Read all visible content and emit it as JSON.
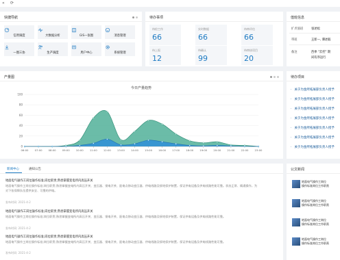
{
  "topbar": {
    "back": "«",
    "refresh": "⟳"
  },
  "quick_nav": {
    "title": "快捷导航",
    "items": [
      {
        "label": "信用调度",
        "icon": "gauge-icon"
      },
      {
        "label": "大数据分析",
        "icon": "pulse-icon"
      },
      {
        "label": "GIS一张图",
        "icon": "book-icon"
      },
      {
        "label": "消息管理",
        "icon": "smile-icon"
      },
      {
        "label": "一图三协",
        "icon": "download-icon"
      },
      {
        "label": "生产调度",
        "icon": "users-icon"
      },
      {
        "label": "用户中心",
        "icon": "user-icon"
      },
      {
        "label": "系统管理",
        "icon": "gear-icon"
      }
    ]
  },
  "todo": {
    "title": "待办事项",
    "items": [
      {
        "label": "待检工作",
        "value": "66"
      },
      {
        "label": "实时数据",
        "value": "66"
      },
      {
        "label": "待审评估",
        "value": "66"
      },
      {
        "label": "待上报",
        "value": "12"
      },
      {
        "label": "待确认",
        "value": "99"
      },
      {
        "label": "待审核项目",
        "value": "20"
      }
    ]
  },
  "note": {
    "title": "值班信息",
    "rows": [
      {
        "key": "扩点值班",
        "value": "张述松"
      },
      {
        "key": "带班",
        "value": "王新一, 谭述毅"
      },
      {
        "key": "备注",
        "value": "西季 \"云控\" 期"
      }
    ],
    "extra": "间有序运行"
  },
  "production": {
    "title": "产量图",
    "chart_title": "今日产量趋势"
  },
  "chart_data": {
    "type": "area",
    "title": "今日产量趋势",
    "x": [
      "06:00",
      "07:00",
      "08:00",
      "09:00",
      "10:00",
      "11:00",
      "12:00",
      "13:00",
      "14:00",
      "15:00",
      "16:00",
      "17:00",
      "18:00",
      "19:00",
      "20:00",
      "21:00",
      "22:00",
      "23:00"
    ],
    "ylim": [
      0,
      100
    ],
    "yticks": [
      "100",
      "80",
      "60",
      "40",
      "20",
      "0"
    ],
    "series": [
      {
        "color": "#3aa58b",
        "values": [
          0,
          0,
          0,
          2,
          12,
          55,
          67,
          13,
          29,
          50,
          43,
          24,
          11,
          7,
          9,
          3,
          2,
          0
        ]
      },
      {
        "color": "#2f8fd8",
        "values": [
          0,
          0,
          0,
          0,
          2,
          6,
          14,
          3,
          5,
          12,
          9,
          5,
          2,
          1,
          2,
          1,
          0,
          0
        ]
      }
    ]
  },
  "pending": {
    "title": "待办项目",
    "items": [
      "关于为金所拓展部负责人授予",
      "关于为金所拓展部负责人授予",
      "关于为金所拓展部负责人授予",
      "关于为金所拓展部负责人授予",
      "关于为金所拓展部负责人授予",
      "关于为金所拓展部负责人授予",
      "关于为金所拓展部负责人授予"
    ]
  },
  "news": {
    "tabs": [
      "新闻中心",
      "通知公告"
    ],
    "items": [
      {
        "title": "地面电气操作工岗位操作标准;岗位职责;熟悉掌握变电所内高压开关",
        "body": "地面电气操作工岗位操作标准;岗位职责;熟悉掌握变电所内高压开关、变压器、馈电开关、配电点移动变压器、供电线路及接地保护装置，保证供电设备及供电线路性能可靠。状态正常、精通操作，为对下各保障队伍提供安全、可靠的供电。",
        "time": "发布时间:  2021-4-2"
      },
      {
        "title": "地面电气操作工岗位操作标准;岗位职责;熟悉掌握变电所内高压开关",
        "body": "地面电气操作工岗位操作标准;岗位职责;熟悉掌握变电所内高压开关、变压器、馈电开关、配电点移动变压器、供电线路及接地保护装置，保证供电设备及供电线路性能可靠。",
        "time": "发布时间:  2021-4-2"
      },
      {
        "title": "地面电气操作工岗位操作标准;岗位职责;熟悉掌握变电所内高压开关",
        "body": "地面电气操作工岗位操作标准;岗位职责;熟悉掌握变电所内高压开关、变压器、馈电开关、配电点移动变压器、供电线路及接地保护装置，保证供电设备及供电线路性能可靠。",
        "time": "发布时间:  2021-4-2"
      }
    ]
  },
  "public": {
    "title": "公文新闻",
    "items": [
      {
        "line1": "地面电气操作工岗位",
        "line2": "操作标准岗位工作职责"
      },
      {
        "line1": "地面电气操作工岗位",
        "line2": "操作标准岗位工作职责"
      },
      {
        "line1": "地面电气操作工岗位",
        "line2": "操作标准岗位工作职责"
      },
      {
        "line1": "地面电气操作工岗位",
        "line2": "操作标准岗位工作职责"
      }
    ]
  }
}
